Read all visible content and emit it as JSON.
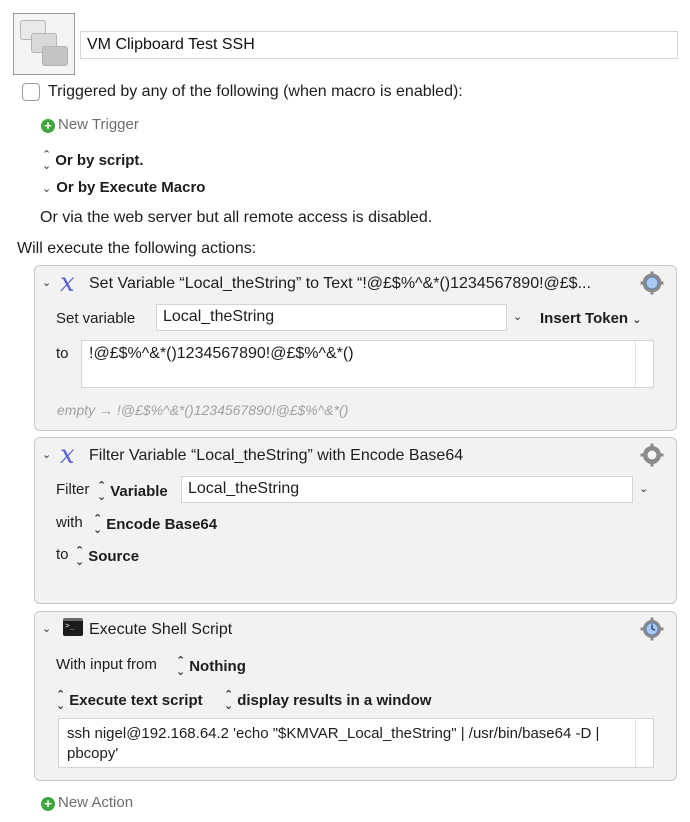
{
  "macro": {
    "name": "VM Clipboard Test SSH"
  },
  "triggers": {
    "checkbox_label": "Triggered by any of the following (when macro is enabled):",
    "new_trigger": "New Trigger",
    "or_by_script": "Or by script.",
    "or_by_execute_macro": "Or by Execute Macro",
    "web_server_note": "Or via the web server but all remote access is disabled."
  },
  "actions_header": "Will execute the following actions:",
  "actions": [
    {
      "title": "Set Variable “Local_theString” to Text “!@£$%^&*()1234567890!@£$...",
      "set_variable_label": "Set variable",
      "variable_name": "Local_theString",
      "insert_token": "Insert Token",
      "to_label": "to",
      "text_value": "!@£$%^&*()1234567890!@£$%^&*()",
      "preview": "empty → !@£$%^&*()1234567890!@£$%^&*()"
    },
    {
      "title": "Filter Variable “Local_theString” with Encode Base64",
      "filter_label": "Filter",
      "variable_type": "Variable",
      "variable_name": "Local_theString",
      "with_label": "with",
      "filter_name": "Encode Base64",
      "to_label": "to",
      "target": "Source"
    },
    {
      "title": "Execute Shell Script",
      "input_label": "With input from",
      "input_value": "Nothing",
      "mode": "Execute text script",
      "results": "display results in a window",
      "script": "ssh nigel@192.168.64.2 'echo \"$KMVAR_Local_theString\" | /usr/bin/base64 -D | pbcopy'"
    }
  ],
  "new_action": "New Action",
  "colors": {
    "panel_bg": "#f2f2f2",
    "variable_icon": "#5b63d8",
    "plus_green": "#3fa63f"
  }
}
